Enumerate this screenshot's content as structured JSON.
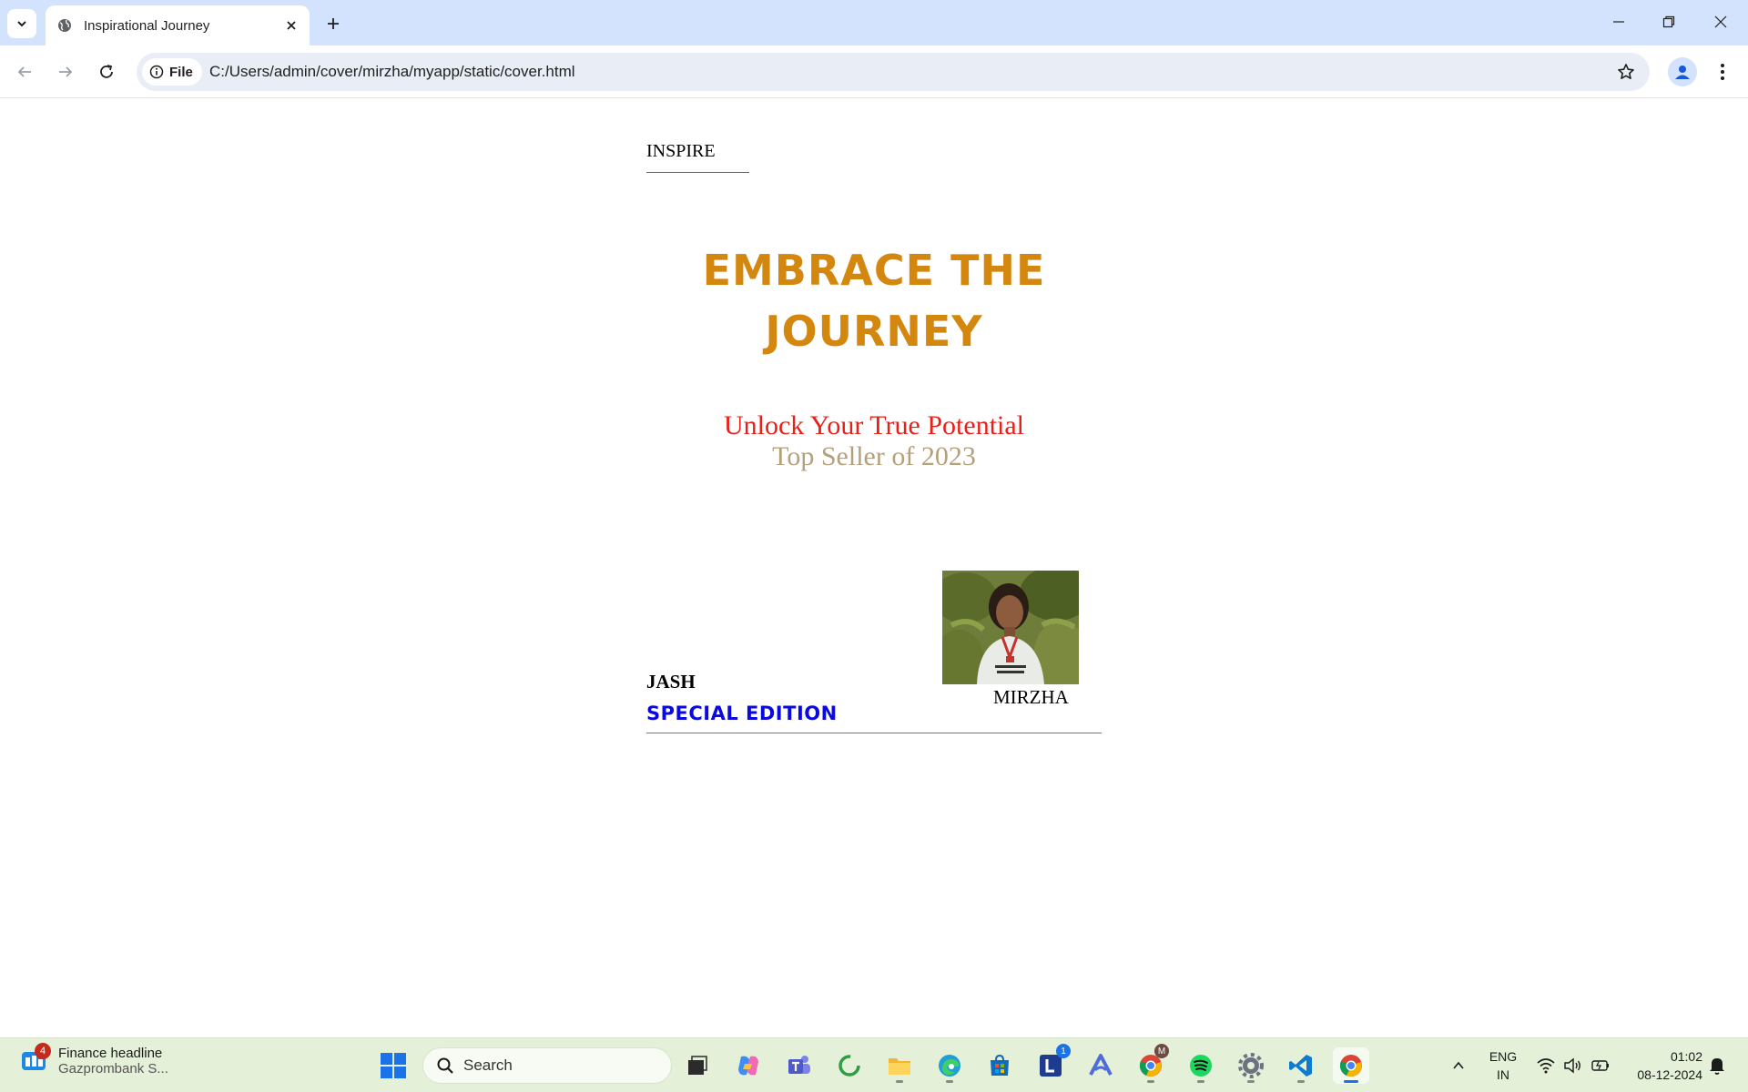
{
  "browser": {
    "tab_title": "Inspirational Journey",
    "chip_label": "File",
    "url": "C:/Users/admin/cover/mirzha/myapp/static/cover.html"
  },
  "cover": {
    "label": "INSPIRE",
    "title": "EMBRACE THE JOURNEY",
    "subtitle": "Unlock Your True Potential",
    "tagline": "Top Seller of 2023",
    "publisher": "JASH",
    "author": "MIRZHA",
    "edition": "SPECIAL EDITION",
    "colors": {
      "title": "#d4870f",
      "subtitle": "#e8201a",
      "tagline": "#b5a07c",
      "edition": "#0a0ae0"
    }
  },
  "taskbar": {
    "news_headline": "Finance headline",
    "news_sub": "Gazprombank S...",
    "news_badge": "4",
    "search_placeholder": "Search",
    "lens_badge": "1",
    "chrome_badge": "M",
    "lang_top": "ENG",
    "lang_bottom": "IN",
    "time": "01:02",
    "date": "08-12-2024",
    "icons": [
      "task-view-icon",
      "copilot-icon",
      "teams-icon",
      "refresh-app-icon",
      "file-explorer-icon",
      "edge-icon",
      "store-icon",
      "lens-icon",
      "arc-icon",
      "chrome-profile-icon",
      "spotify-icon",
      "settings-icon",
      "vscode-icon",
      "chrome-icon"
    ]
  }
}
